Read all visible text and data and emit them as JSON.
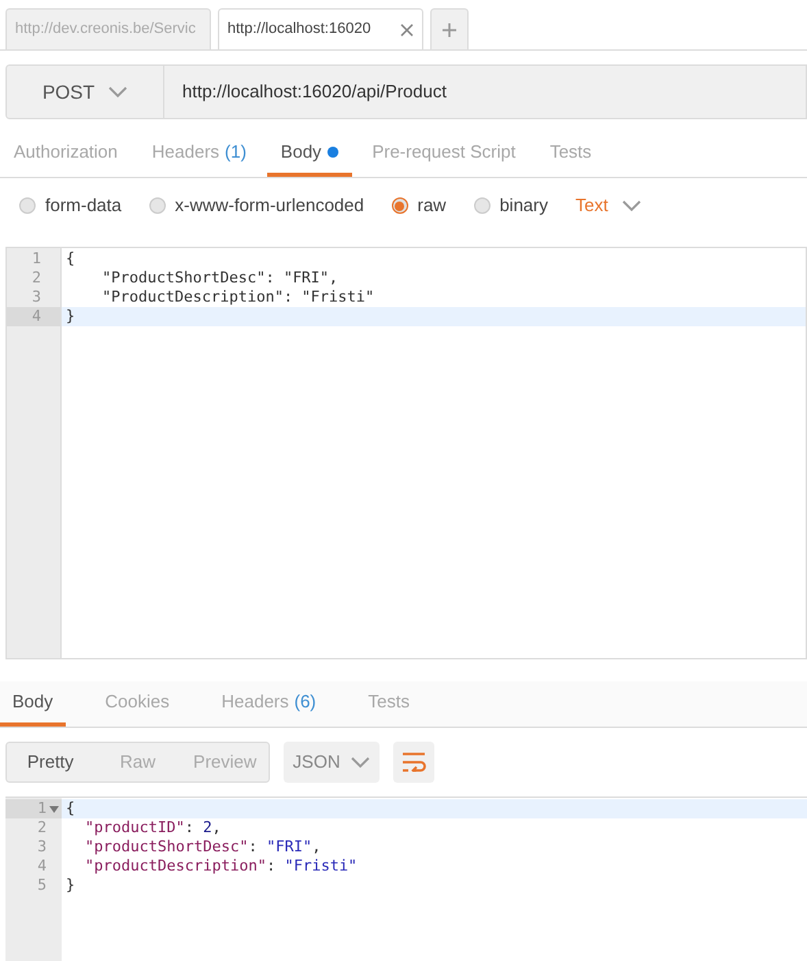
{
  "browser_tabs": [
    {
      "title": "http://dev.creonis.be/Servic",
      "selected": false,
      "closable": false
    },
    {
      "title": "http://localhost:16020",
      "selected": true,
      "closable": true
    }
  ],
  "request": {
    "method": "POST",
    "url": "http://localhost:16020/api/Product"
  },
  "request_tabs": [
    {
      "label": "Authorization",
      "selected": false
    },
    {
      "label": "Headers",
      "count": "(1)",
      "selected": false
    },
    {
      "label": "Body",
      "modified": true,
      "selected": true
    },
    {
      "label": "Pre-request Script",
      "selected": false
    },
    {
      "label": "Tests",
      "selected": false
    }
  ],
  "body_types": [
    {
      "label": "form-data",
      "selected": false
    },
    {
      "label": "x-www-form-urlencoded",
      "selected": false
    },
    {
      "label": "raw",
      "selected": true
    },
    {
      "label": "binary",
      "selected": false
    }
  ],
  "raw_format": "Text",
  "request_body": [
    {
      "number": "1",
      "text": "{",
      "active": false
    },
    {
      "number": "2",
      "text": "    \"ProductShortDesc\": \"FRI\",",
      "active": false
    },
    {
      "number": "3",
      "text": "    \"ProductDescription\": \"Fristi\"",
      "active": false
    },
    {
      "number": "4",
      "text": "}",
      "active": true
    }
  ],
  "response_tabs": [
    {
      "label": "Body",
      "selected": true
    },
    {
      "label": "Cookies",
      "selected": false
    },
    {
      "label": "Headers",
      "count": "(6)",
      "selected": false
    },
    {
      "label": "Tests",
      "selected": false
    }
  ],
  "view_modes": [
    {
      "label": "Pretty",
      "selected": true
    },
    {
      "label": "Raw",
      "selected": false
    },
    {
      "label": "Preview",
      "selected": false
    }
  ],
  "response_format": "JSON",
  "response_body": [
    {
      "number": "1",
      "foldable": true,
      "active": true,
      "indented": false,
      "tokens": [
        {
          "kind": "punct",
          "text": "{"
        }
      ]
    },
    {
      "number": "2",
      "foldable": false,
      "active": false,
      "indented": true,
      "tokens": [
        {
          "kind": "key",
          "text": "\"productID\""
        },
        {
          "kind": "punct",
          "text": ": "
        },
        {
          "kind": "number",
          "text": "2"
        },
        {
          "kind": "punct",
          "text": ","
        }
      ]
    },
    {
      "number": "3",
      "foldable": false,
      "active": false,
      "indented": true,
      "tokens": [
        {
          "kind": "key",
          "text": "\"productShortDesc\""
        },
        {
          "kind": "punct",
          "text": ": "
        },
        {
          "kind": "string",
          "text": "\"FRI\""
        },
        {
          "kind": "punct",
          "text": ","
        }
      ]
    },
    {
      "number": "4",
      "foldable": false,
      "active": false,
      "indented": true,
      "tokens": [
        {
          "kind": "key",
          "text": "\"productDescription\""
        },
        {
          "kind": "punct",
          "text": ": "
        },
        {
          "kind": "string",
          "text": "\"Fristi\""
        }
      ]
    },
    {
      "number": "5",
      "foldable": false,
      "active": false,
      "indented": false,
      "tokens": [
        {
          "kind": "punct",
          "text": "}"
        }
      ]
    }
  ]
}
